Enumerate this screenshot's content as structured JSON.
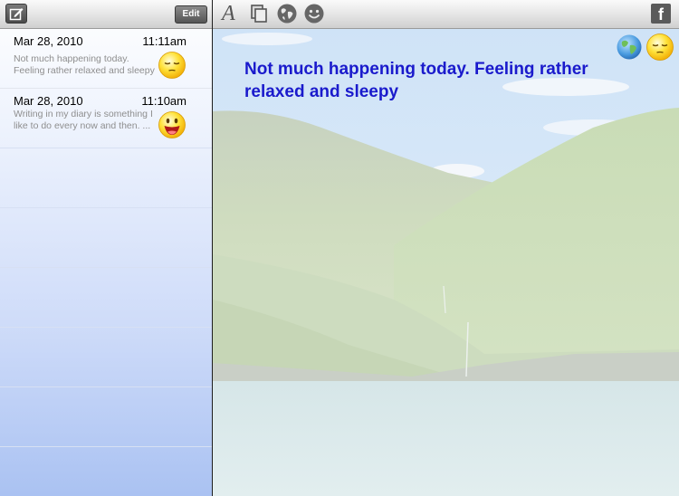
{
  "sidebar": {
    "toolbar": {
      "compose_icon": "compose-icon",
      "edit_label": "Edit"
    },
    "entries": [
      {
        "date": "Mar 28, 2010",
        "time": "11:11am",
        "preview": "Not much happening today. Feeling rather relaxed and sleepy",
        "mood": "sleepy-face"
      },
      {
        "date": "Mar 28, 2010",
        "time": "11:10am",
        "preview": "Writing in my diary is something I like to do every now and then. ...",
        "mood": "happy-face"
      }
    ]
  },
  "main": {
    "toolbar": {
      "icons": [
        "font-icon",
        "copy-icon",
        "globe-icon",
        "smiley-icon",
        "facebook-icon"
      ],
      "facebook_letter": "f"
    },
    "entry_text": "Not much happening today. Feeling rather relaxed and sleepy",
    "corner_icons": [
      "globe-icon",
      "sleepy-face-icon"
    ]
  },
  "colors": {
    "entry_text": "#1a1acc",
    "sidebar_bottom": "#aac2f2",
    "toolbar": "#e6e6e6"
  }
}
